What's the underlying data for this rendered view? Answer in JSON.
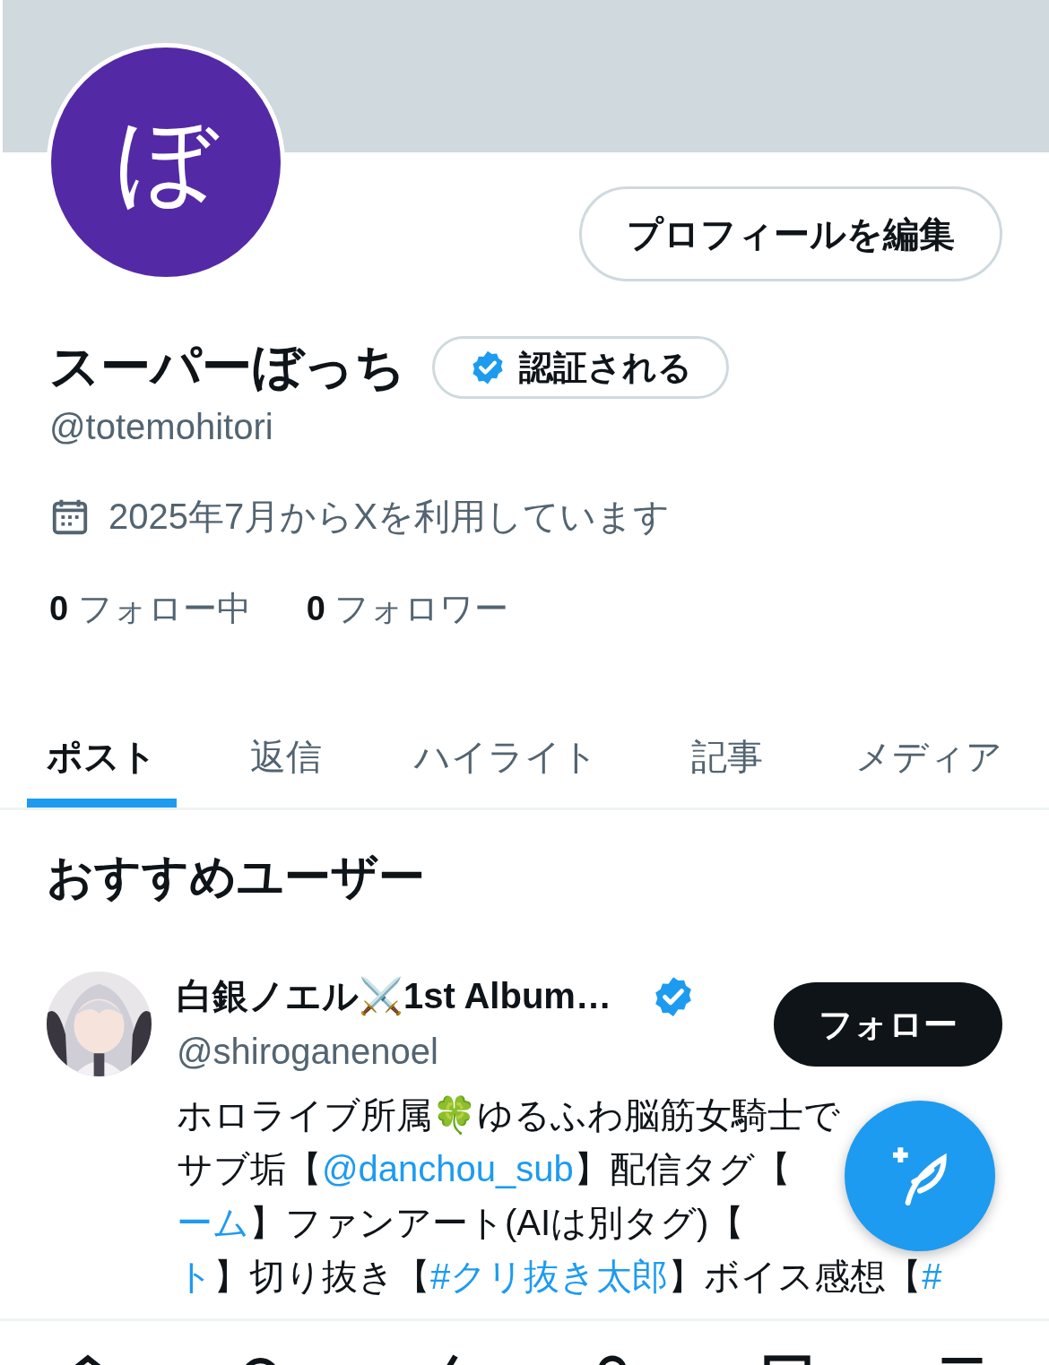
{
  "profile": {
    "avatar_letter": "ぼ",
    "edit_button": "プロフィールを編集",
    "name": "スーパーぼっち",
    "verify_badge": "認証される",
    "handle": "@totemohitori",
    "joined": "2025年7月からXを利用しています",
    "following": {
      "count": "0",
      "label": "フォロー中"
    },
    "followers": {
      "count": "0",
      "label": "フォロワー"
    }
  },
  "tabs": [
    {
      "label": "ポスト",
      "selected": true
    },
    {
      "label": "返信",
      "selected": false
    },
    {
      "label": "ハイライト",
      "selected": false
    },
    {
      "label": "記事",
      "selected": false
    },
    {
      "label": "メディア",
      "selected": false
    }
  ],
  "suggestions": {
    "title": "おすすめユーザー",
    "users": [
      {
        "name": "白銀ノエル⚔️1st Album…",
        "verified": true,
        "handle": "@shiroganenoel",
        "follow_button": "フォロー",
        "bio_lines": [
          [
            {
              "text": "ホロライブ所属🍀ゆるふわ脳筋女騎士で",
              "link": false
            }
          ],
          [
            {
              "text": "サブ垢【",
              "link": false
            },
            {
              "text": "@danchou_sub",
              "link": true
            },
            {
              "text": "】配信タグ【",
              "link": false
            }
          ],
          [
            {
              "text": "ーム",
              "link": true
            },
            {
              "text": "】ファンアート(AIは別タグ)【",
              "link": false
            }
          ],
          [
            {
              "text": "ト",
              "link": true
            },
            {
              "text": "】切り抜き【",
              "link": false
            },
            {
              "text": "#クリ抜き太郎",
              "link": true
            },
            {
              "text": "】ボイス感想【",
              "link": false
            },
            {
              "text": "#",
              "link": true
            }
          ]
        ]
      }
    ]
  }
}
